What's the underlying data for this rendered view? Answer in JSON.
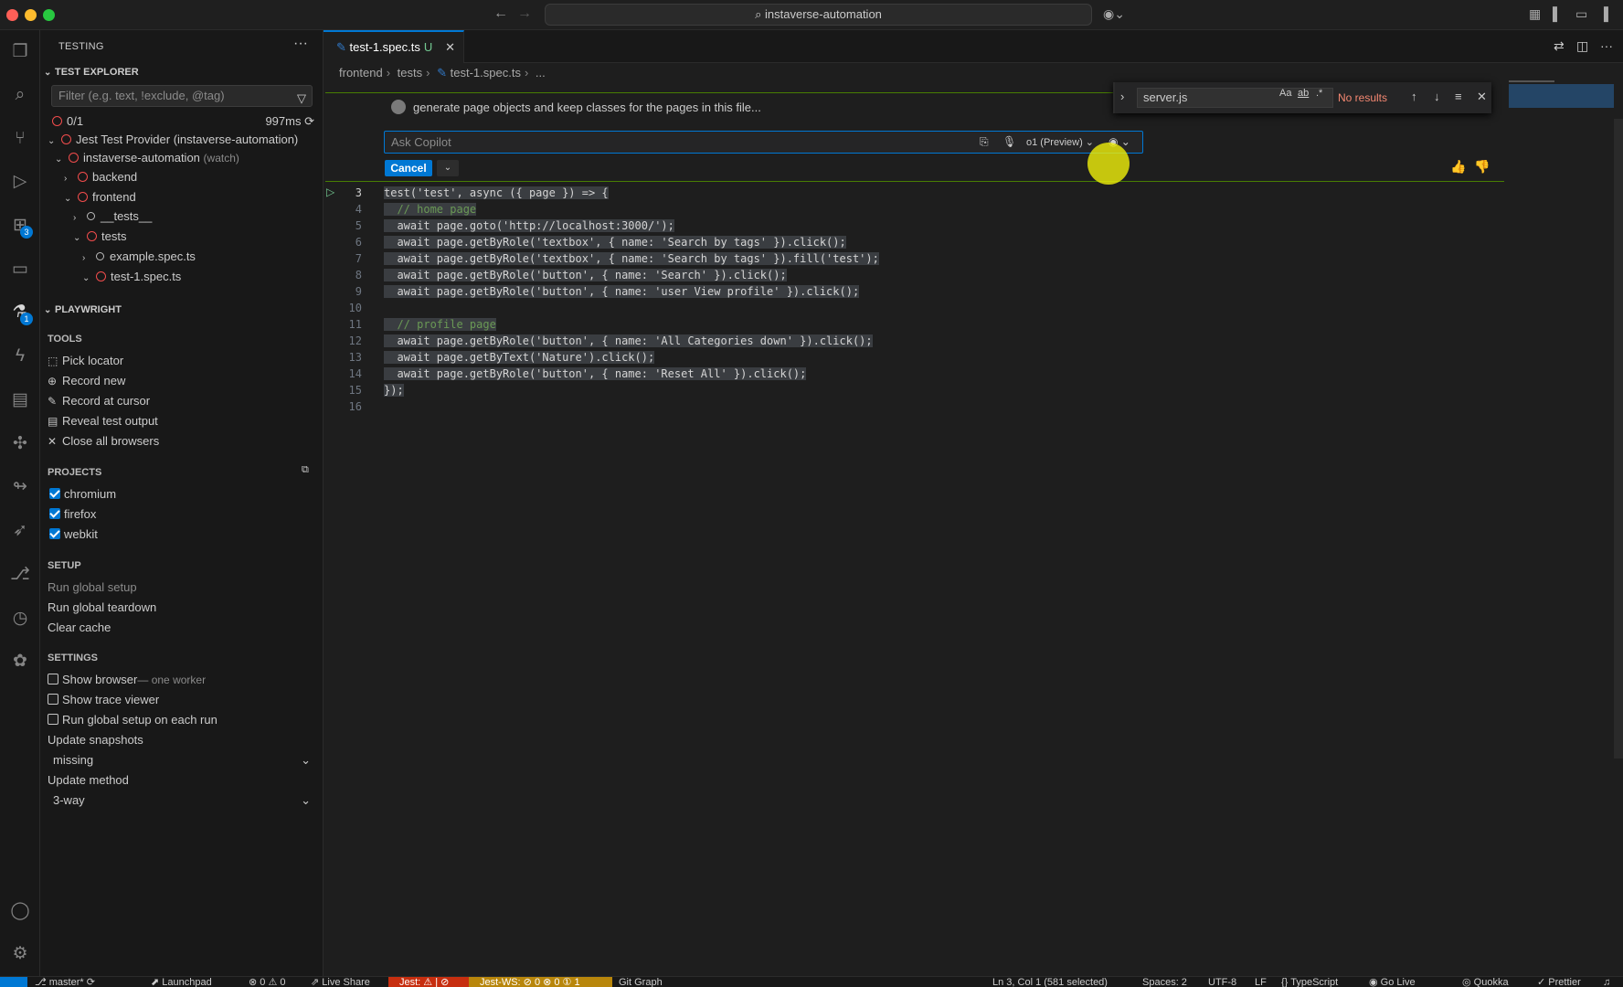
{
  "window": {
    "search": "instaverse-automation"
  },
  "activity": {
    "extensions_badge": "3",
    "testing_badge": "1"
  },
  "sidebar": {
    "title": "TESTING",
    "more": "···",
    "test_explorer": {
      "header": "TEST EXPLORER",
      "filter_placeholder": "Filter (e.g. text, !exclude, @tag)",
      "result": "0/1",
      "duration": "997ms",
      "tree": [
        {
          "label": "Jest Test Provider (instaverse-automation)"
        },
        {
          "label": "instaverse-automation",
          "suffix": "(watch)"
        },
        {
          "label": "backend"
        },
        {
          "label": "frontend"
        },
        {
          "label": "__tests__"
        },
        {
          "label": "tests"
        },
        {
          "label": "example.spec.ts"
        },
        {
          "label": "test-1.spec.ts"
        }
      ]
    },
    "playwright": {
      "header": "PLAYWRIGHT",
      "tools_header": "TOOLS",
      "tools": [
        "Pick locator",
        "Record new",
        "Record at cursor",
        "Reveal test output",
        "Close all browsers"
      ],
      "projects_header": "PROJECTS",
      "projects": [
        {
          "label": "chromium",
          "checked": true
        },
        {
          "label": "firefox",
          "checked": true
        },
        {
          "label": "webkit",
          "checked": true
        }
      ],
      "setup_header": "SETUP",
      "setup": [
        "Run global setup",
        "Run global teardown",
        "Clear cache"
      ],
      "settings_header": "SETTINGS",
      "show_browser": "Show browser",
      "show_browser_hint": "— one worker",
      "show_trace": "Show trace viewer",
      "run_global_each": "Run global setup on each run",
      "update_snapshots": "Update snapshots",
      "update_snapshots_value": "missing",
      "update_method": "Update method",
      "update_method_value": "3-way"
    }
  },
  "editor": {
    "tab": {
      "label": "test-1.spec.ts",
      "status": "U"
    },
    "breadcrumb": [
      "frontend",
      "tests",
      "test-1.spec.ts",
      "..."
    ],
    "copilot": {
      "prompt": "generate page objects and keep classes for the pages in this file...",
      "placeholder": "Ask Copilot",
      "model": "o1 (Preview)",
      "cancel": "Cancel"
    },
    "find": {
      "value": "server.js",
      "case": "Aa",
      "word": "ab",
      "regex": ".*",
      "result": "No results"
    },
    "lines": [
      {
        "n": "3",
        "text": "test('test', async ({ page }) => {"
      },
      {
        "n": "4",
        "text": "  // home page"
      },
      {
        "n": "5",
        "text": "  await page.goto('http://localhost:3000/');"
      },
      {
        "n": "6",
        "text": "  await page.getByRole('textbox', { name: 'Search by tags' }).click();"
      },
      {
        "n": "7",
        "text": "  await page.getByRole('textbox', { name: 'Search by tags' }).fill('test');"
      },
      {
        "n": "8",
        "text": "  await page.getByRole('button', { name: 'Search' }).click();"
      },
      {
        "n": "9",
        "text": "  await page.getByRole('button', { name: 'user View profile' }).click();"
      },
      {
        "n": "10",
        "text": ""
      },
      {
        "n": "11",
        "text": "  // profile page"
      },
      {
        "n": "12",
        "text": "  await page.getByRole('button', { name: 'All Categories down' }).click();"
      },
      {
        "n": "13",
        "text": "  await page.getByText('Nature').click();"
      },
      {
        "n": "14",
        "text": "  await page.getByRole('button', { name: 'Reset All' }).click();"
      },
      {
        "n": "15",
        "text": "});"
      },
      {
        "n": "16",
        "text": ""
      }
    ]
  },
  "status": {
    "branch": "master*",
    "launchpad": "Launchpad",
    "problems": "⊗ 0 ⚠ 0",
    "liveshare": "Live Share",
    "jest": "Jest: ⚠ | ⊘",
    "jestws": "Jest-WS: ⊘ 0 ⊗ 0 ① 1",
    "gitgraph": "Git Graph",
    "position": "Ln 3, Col 1 (581 selected)",
    "spaces": "Spaces: 2",
    "encoding": "UTF-8",
    "eol": "LF",
    "language": "TypeScript",
    "golive": "Go Live",
    "quokka": "Quokka",
    "prettier": "Prettier"
  }
}
